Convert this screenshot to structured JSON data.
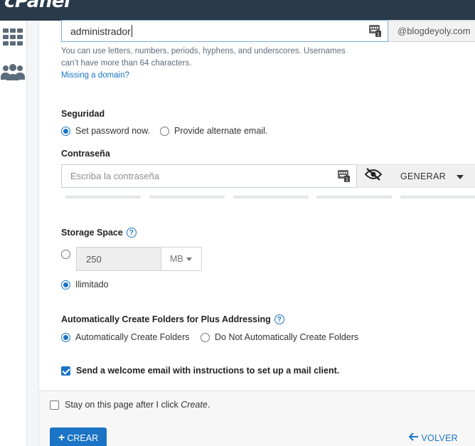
{
  "app": {
    "logo_text": "cPanel"
  },
  "sidebar": {
    "items": [
      {
        "icon": "grid-icon"
      },
      {
        "icon": "users-icon"
      }
    ]
  },
  "username": {
    "value": "administrador",
    "domain_suffix": "@blogdeyoly.com",
    "help_line1": "You can use letters, numbers, periods, hyphens, and underscores. Usernames",
    "help_line2": "can’t have more than 64 characters.",
    "missing_domain_link": "Missing a domain?"
  },
  "security": {
    "label": "Seguridad",
    "options": [
      {
        "label": "Set password now.",
        "selected": true
      },
      {
        "label": "Provide alternate email.",
        "selected": false
      }
    ]
  },
  "password": {
    "label": "Contraseña",
    "placeholder": "Escriba la contraseña",
    "generate_label": "GENERAR",
    "strength_segments": 5
  },
  "storage": {
    "label": "Storage Space",
    "quota_value": "250",
    "unit": "MB",
    "unlimited_label": "Ilimitado",
    "unlimited_selected": true
  },
  "plus_addressing": {
    "label": "Automatically Create Folders for Plus Addressing",
    "options": [
      {
        "label": "Automatically Create Folders",
        "selected": true
      },
      {
        "label": "Do Not Automatically Create Folders",
        "selected": false
      }
    ]
  },
  "welcome_email": {
    "label": "Send a welcome email with instructions to set up a mail client.",
    "checked": true
  },
  "footer": {
    "stay_label_prefix": "Stay on this page after I click ",
    "stay_label_emphasis": "Create",
    "stay_label_suffix": ".",
    "stay_checked": false,
    "create_button": "CREAR",
    "back_link": "VOLVER"
  },
  "colors": {
    "topbar": "#293a4a",
    "accent": "#1b74c5"
  }
}
